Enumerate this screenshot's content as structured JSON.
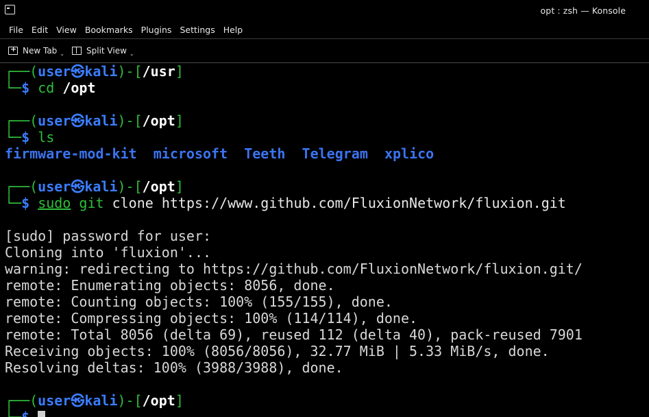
{
  "window": {
    "title": "opt : zsh — Konsole"
  },
  "menubar": {
    "items": [
      "File",
      "Edit",
      "View",
      "Bookmarks",
      "Plugins",
      "Settings",
      "Help"
    ]
  },
  "toolbar": {
    "new_tab": "New Tab",
    "split_view": "Split View",
    "new_tab_icon": "new-tab-icon",
    "split_view_icon": "split-view-icon",
    "dropdown_caret": "⌄"
  },
  "terminal": {
    "prompt": {
      "corner_top": "┌──(",
      "user": "user",
      "at_symbol": "㉿",
      "host": "kali",
      "mid": ")-[",
      "close": "]",
      "corner_bottom": "└─",
      "dollar": "$ "
    },
    "blocks": [
      {
        "cwd": "/usr",
        "command": "cd",
        "args": " /opt"
      },
      {
        "cwd": "/opt",
        "command": "ls",
        "args": ""
      },
      {
        "cwd": "/opt",
        "command_sudo": "sudo",
        "command_git": "git",
        "args": " clone https://www.github.com/FluxionNetwork/fluxion.git"
      },
      {
        "cwd": "/opt"
      }
    ],
    "ls_output": [
      "firmware-mod-kit",
      "microsoft",
      "Teeth",
      "Telegram",
      "xplico"
    ],
    "clone_output": [
      "[sudo] password for user:",
      "Cloning into 'fluxion'...",
      "warning: redirecting to https://github.com/FluxionNetwork/fluxion.git/",
      "remote: Enumerating objects: 8056, done.",
      "remote: Counting objects: 100% (155/155), done.",
      "remote: Compressing objects: 100% (114/114), done.",
      "remote: Total 8056 (delta 69), reused 112 (delta 40), pack-reused 7901",
      "Receiving objects: 100% (8056/8056), 32.77 MiB | 5.33 MiB/s, done.",
      "Resolving deltas: 100% (3988/3988), done."
    ]
  },
  "colors": {
    "background": "#000000",
    "prompt_green": "#2fbf3b",
    "prompt_blue": "#3b7dff",
    "directory_blue": "#3b74f0",
    "text": "#d8d8d8"
  }
}
